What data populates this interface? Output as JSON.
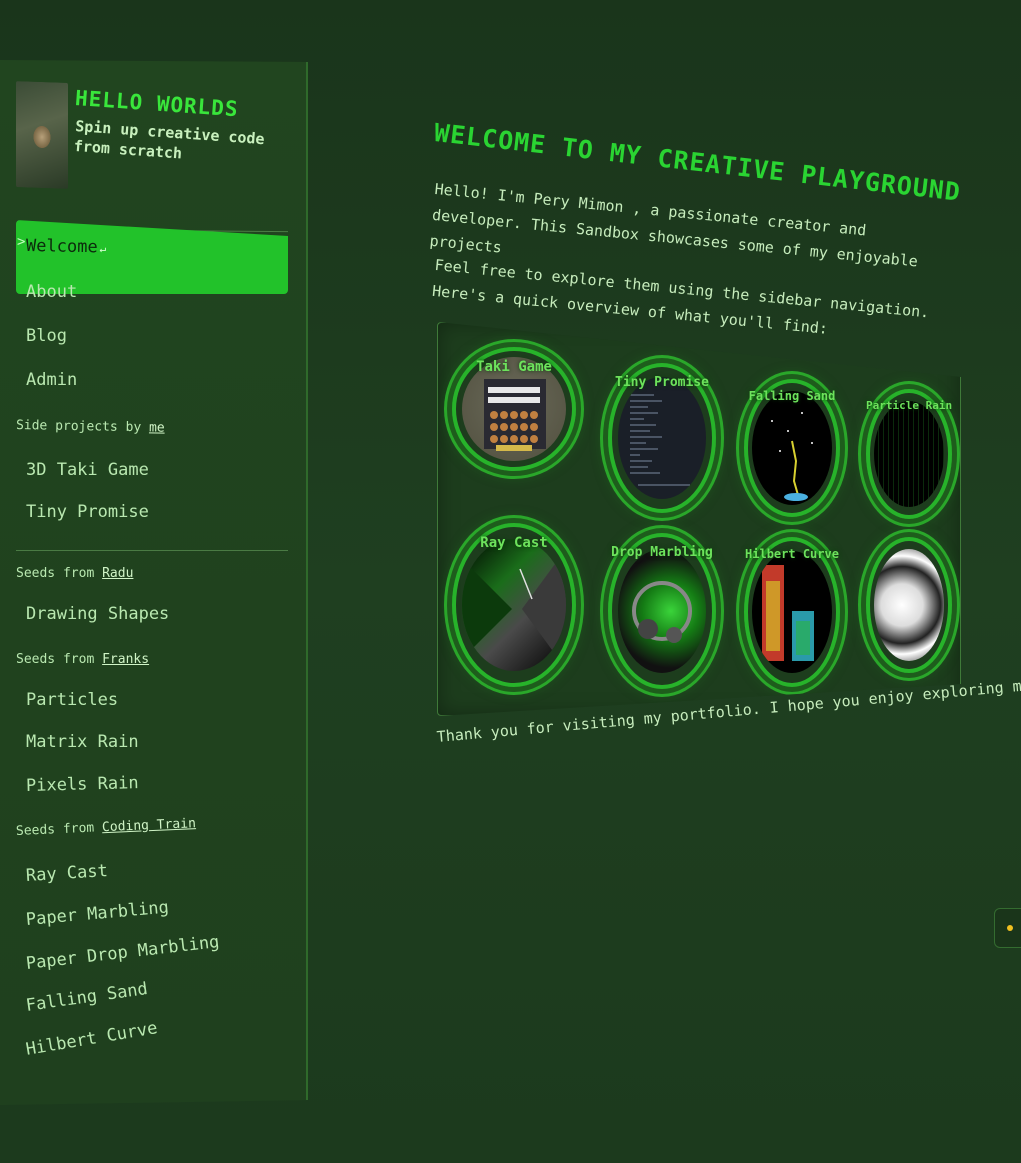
{
  "site": {
    "title": "HELLO WORLDS",
    "tagline": "Spin up creative code from scratch"
  },
  "sidebar": {
    "nav": [
      {
        "label": "Welcome",
        "active": true
      },
      {
        "label": "About"
      },
      {
        "label": "Blog"
      },
      {
        "label": "Admin"
      }
    ],
    "sections": [
      {
        "prefix": "Side projects by",
        "link": "me",
        "items": [
          "3D Taki Game",
          "Tiny Promise"
        ]
      },
      {
        "prefix": "Seeds from",
        "link": "Radu",
        "items": [
          "Drawing Shapes"
        ]
      },
      {
        "prefix": "Seeds from",
        "link": "Franks",
        "items": [
          "Particles",
          "Matrix Rain",
          "Pixels Rain"
        ]
      },
      {
        "prefix": "Seeds from",
        "link": "Coding Train",
        "items": [
          "Ray Cast",
          "Paper Marbling",
          "Paper Drop Marbling",
          "Falling Sand",
          "Hilbert Curve"
        ]
      }
    ]
  },
  "main": {
    "title": "WELCOME TO MY CREATIVE PLAYGROUND",
    "intro": "Hello! I'm Pery Mimon , a passionate creator and developer. This Sandbox showcases some of my enjoyable projects",
    "explore": "Feel free to explore them using the sidebar navigation. Here's a quick overview of what you'll find:",
    "gallery": [
      {
        "label": "Taki Game"
      },
      {
        "label": "Tiny Promise"
      },
      {
        "label": "Falling Sand"
      },
      {
        "label": "Particle Rain"
      },
      {
        "label": "Ray Cast"
      },
      {
        "label": "Drop Marbling"
      },
      {
        "label": "Hilbert Curve"
      },
      {
        "label": ""
      }
    ],
    "thanks": "Thank you for visiting my portfolio. I hope you enjoy exploring my work!"
  },
  "colors": {
    "accent": "#22c22a",
    "title": "#2ad432",
    "background": "#1c3a1d",
    "status_dot": "#f0c020"
  }
}
